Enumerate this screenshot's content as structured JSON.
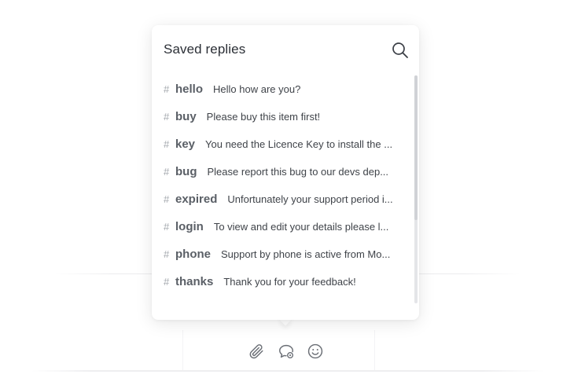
{
  "popup": {
    "title": "Saved replies"
  },
  "replies": [
    {
      "key": "hello",
      "text": "Hello how are you?"
    },
    {
      "key": "buy",
      "text": "Please buy this item first!"
    },
    {
      "key": "key",
      "text": "You need the Licence Key to install the ..."
    },
    {
      "key": "bug",
      "text": "Please report this bug to our devs dep..."
    },
    {
      "key": "expired",
      "text": "Unfortunately your support period i..."
    },
    {
      "key": "login",
      "text": "To view and edit your details please l..."
    },
    {
      "key": "phone",
      "text": "Support by phone is active from Mo..."
    },
    {
      "key": "thanks",
      "text": "Thank you for your feedback!"
    }
  ],
  "hash_symbol": "#",
  "icons": {
    "search": "search-icon",
    "attach": "paperclip-icon",
    "saved_replies": "chat-bubble-icon",
    "emoji": "smiley-icon"
  },
  "colors": {
    "title": "#2b2f36",
    "key": "#5a5f66",
    "text": "#3f4349",
    "icon": "#6b6f76"
  }
}
